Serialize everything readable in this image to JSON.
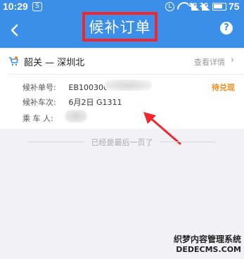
{
  "status_bar": {
    "time": "10:29",
    "sub_icon": "S",
    "signal_1": "4G",
    "signal_2": "2G",
    "battery": "75"
  },
  "header": {
    "title": "候补订单",
    "back_icon": "chevron-left-icon",
    "help_icon": "question-icon",
    "help_glyph": "?",
    "accent_color": "#3b8fe9",
    "highlight_color": "#f0262e"
  },
  "order": {
    "route": "韶关 — 深圳北",
    "detail_link": "查看详情",
    "status": "待兑现",
    "status_color": "#f08a1b",
    "fields": [
      {
        "label": "候补单号:",
        "value": "EB100300"
      },
      {
        "label": "候补车次:",
        "value": "6月2日 G1311"
      },
      {
        "label": "乘 车 人:",
        "value": ""
      }
    ]
  },
  "footer": {
    "end_text": "已经是最后一页了"
  },
  "watermark": {
    "line1": "织梦内容管理系统",
    "line2": "DEDECMS.COM"
  }
}
